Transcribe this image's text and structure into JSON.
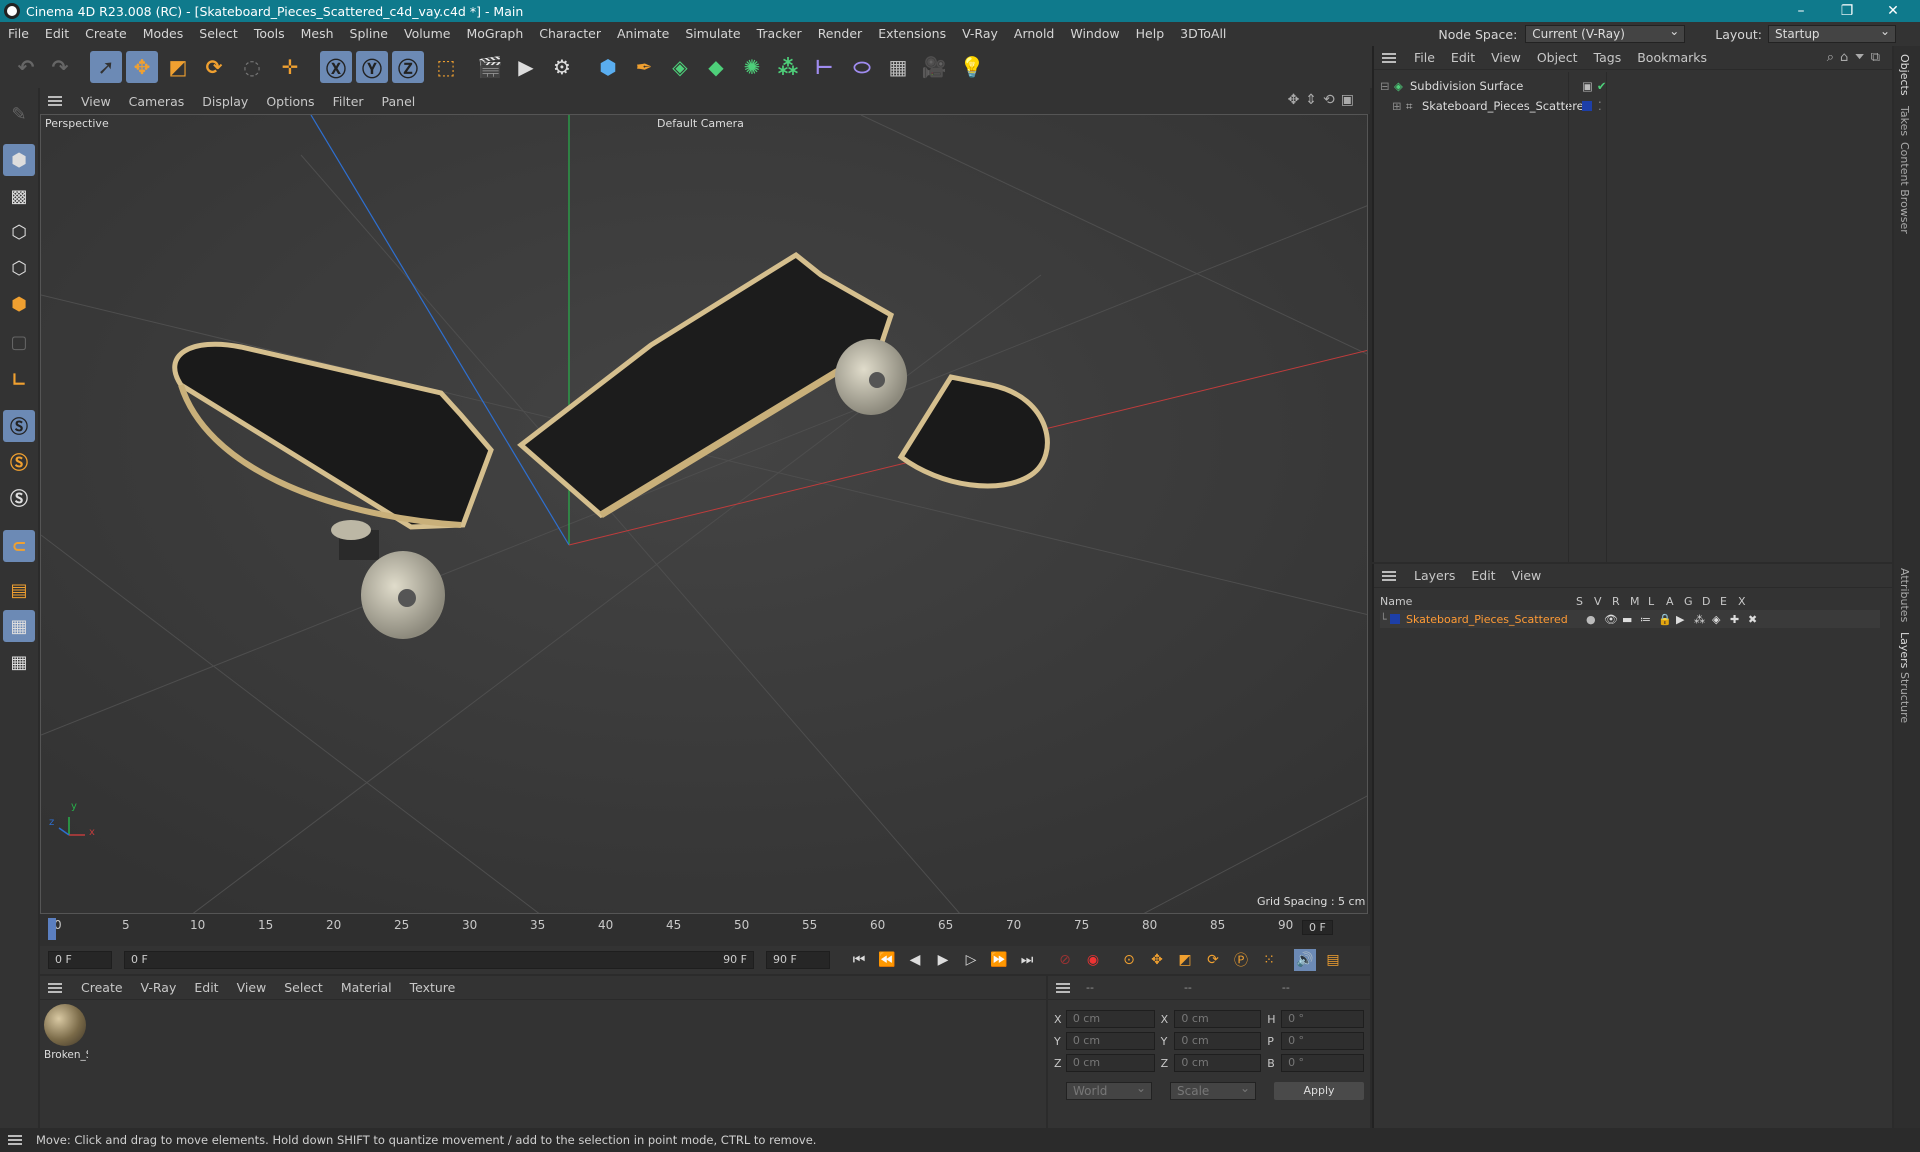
{
  "window": {
    "title": "Cinema 4D R23.008 (RC) - [Skateboard_Pieces_Scattered_c4d_vay.c4d *] - Main",
    "controls": [
      "–",
      "❐",
      "✕"
    ]
  },
  "menu": {
    "items": [
      "File",
      "Edit",
      "Create",
      "Modes",
      "Select",
      "Tools",
      "Mesh",
      "Spline",
      "Volume",
      "MoGraph",
      "Character",
      "Animate",
      "Simulate",
      "Tracker",
      "Render",
      "Extensions",
      "V-Ray",
      "Arnold",
      "Window",
      "Help",
      "3DToAll"
    ],
    "node_space_label": "Node Space:",
    "node_space_value": "Current (V-Ray)",
    "layout_label": "Layout:",
    "layout_value": "Startup"
  },
  "viewport": {
    "menu": [
      "View",
      "Cameras",
      "Display",
      "Options",
      "Filter",
      "Panel"
    ],
    "view_name": "Perspective",
    "camera": "Default Camera",
    "grid_spacing": "Grid Spacing : 5 cm",
    "axis_x": "x",
    "axis_y": "y",
    "axis_z": "z"
  },
  "timeline": {
    "ticks": [
      "0",
      "5",
      "10",
      "15",
      "20",
      "25",
      "30",
      "35",
      "40",
      "45",
      "50",
      "55",
      "60",
      "65",
      "70",
      "75",
      "80",
      "85",
      "90"
    ],
    "current_frame": "0 F",
    "end_frame_field": "0 F"
  },
  "playback": {
    "start": "0 F",
    "range_start": "0 F",
    "range_end": "90 F",
    "end": "90 F"
  },
  "material_manager": {
    "menu": [
      "Create",
      "V-Ray",
      "Edit",
      "View",
      "Select",
      "Material",
      "Texture"
    ],
    "material_name": "Broken_S"
  },
  "coordinates": {
    "header": [
      "--",
      "--",
      "--"
    ],
    "rows": [
      {
        "a": "X",
        "v1": "0 cm",
        "b": "X",
        "v2": "0 cm",
        "c": "H",
        "v3": "0 °"
      },
      {
        "a": "Y",
        "v1": "0 cm",
        "b": "Y",
        "v2": "0 cm",
        "c": "P",
        "v3": "0 °"
      },
      {
        "a": "Z",
        "v1": "0 cm",
        "b": "Z",
        "v2": "0 cm",
        "c": "B",
        "v3": "0 °"
      }
    ],
    "mode1": "World",
    "mode2": "Scale",
    "apply": "Apply"
  },
  "object_manager": {
    "menu": [
      "File",
      "Edit",
      "View",
      "Object",
      "Tags",
      "Bookmarks"
    ],
    "objects": [
      "Subdivision Surface",
      "Skateboard_Pieces_Scattered"
    ]
  },
  "layer_manager": {
    "menu": [
      "Layers",
      "Edit",
      "View"
    ],
    "col_name": "Name",
    "cols": [
      "S",
      "V",
      "R",
      "M",
      "L",
      "A",
      "G",
      "D",
      "E",
      "X"
    ],
    "layer_name": "Skateboard_Pieces_Scattered"
  },
  "side_tabs": [
    "Objects",
    "Takes",
    "Content Browser",
    "Attributes",
    "Layers",
    "Structure"
  ],
  "status": "Move: Click and drag to move elements. Hold down SHIFT to quantize movement / add to the selection in point mode, CTRL to remove.",
  "colors": {
    "title_bar": "#0f7a8c",
    "accent": "#6c8ab5",
    "layer_text": "#ff9b35",
    "layer_color": "#1d3fa8"
  }
}
